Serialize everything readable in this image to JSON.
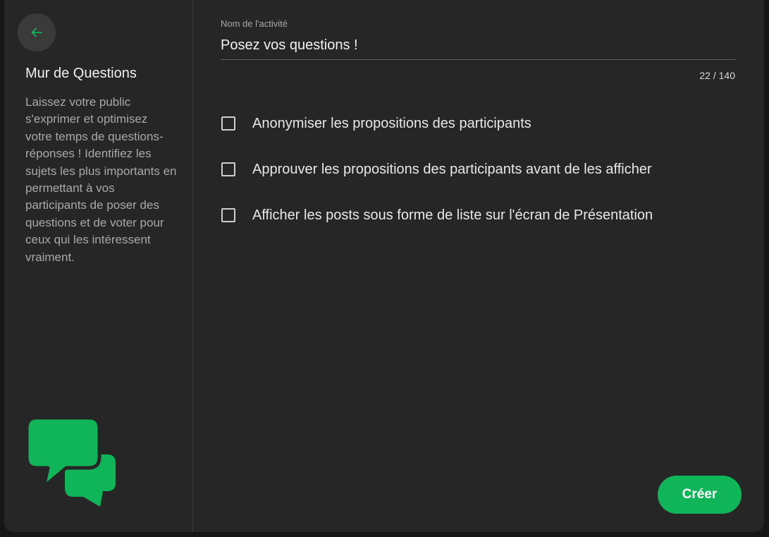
{
  "colors": {
    "accent": "#10b559",
    "dialog_bg": "#262626",
    "text_primary": "#f0f0f0",
    "text_secondary": "#a9a9a9"
  },
  "sidebar": {
    "back_icon": "arrow-left-icon",
    "title": "Mur de Questions",
    "description": "Laissez votre public s'exprimer et optimisez votre temps de questions-réponses ! Identifiez les sujets les plus importants en permettant à vos participants de poser des questions et de voter pour ceux qui les intéressent vraiment.",
    "logo_icon": "speech-bubbles-icon"
  },
  "form": {
    "name_label": "Nom de l'activité",
    "name_value": "Posez vos questions !",
    "char_counter": "22 / 140",
    "options": [
      {
        "label": "Anonymiser les propositions des participants",
        "checked": false
      },
      {
        "label": "Approuver les propositions des participants avant de les afficher",
        "checked": false
      },
      {
        "label": "Afficher les posts sous forme de liste sur l'écran de Présentation",
        "checked": false
      }
    ],
    "create_label": "Créer"
  }
}
